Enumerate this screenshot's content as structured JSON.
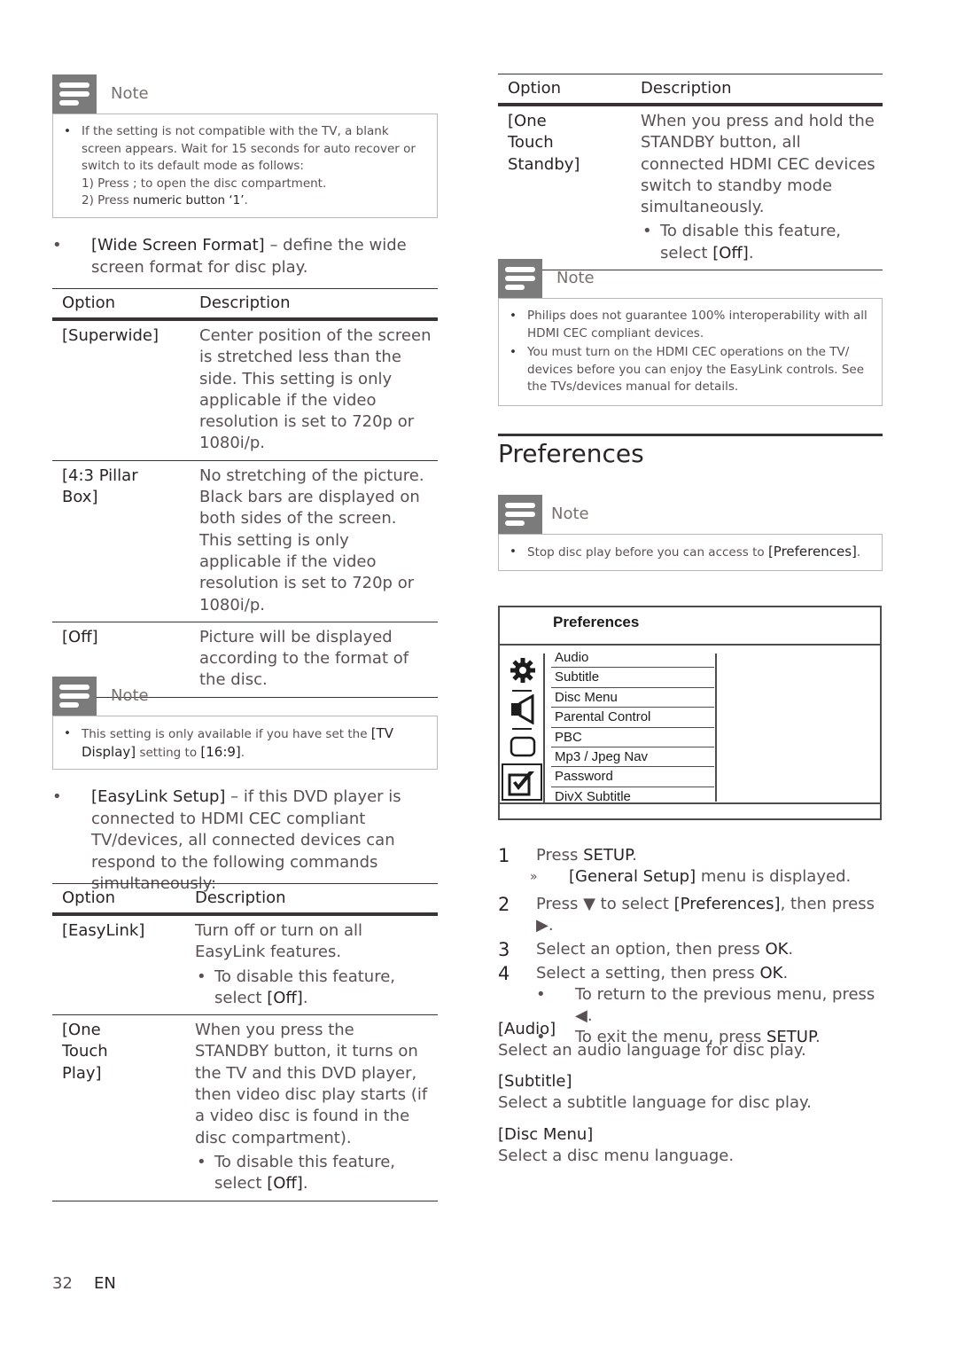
{
  "left": {
    "note1": {
      "title": "Note",
      "line1": "If the setting is not compatible with the TV, a blank screen appears.  Wait for 15 seconds for auto recover or switch to its default mode as follows:",
      "line2_pre": "1) Press  ;  to open the disc compartment.",
      "line3_pre": "2) Press ",
      "line3_bold": "numeric button ‘1’",
      "line3_post": "."
    },
    "wide_screen": {
      "bullet": "•",
      "term": "[Wide Screen Format]",
      "desc": " – define the wide screen format for disc play."
    },
    "table1": {
      "header": {
        "option": "Option",
        "description": "Description"
      },
      "rows": [
        {
          "option": "[Superwide]",
          "description": "Center position of the screen is stretched less than the side. This setting is only applicable if the video resolution is set to 720p or 1080i/p."
        },
        {
          "option": "[4:3 Pillar Box]",
          "description": "No stretching of the picture. Black bars are displayed on both sides of the screen. This setting is only applicable if the video resolution is set to 720p or 1080i/p."
        },
        {
          "option": "[Off]",
          "description": "Picture will be displayed according to the format of the disc."
        }
      ]
    },
    "note2": {
      "title": "Note",
      "pre": "This setting is only available if you have set the ",
      "bold1": "[TV Display]",
      "mid": " setting to ",
      "bold2": "[16:9]",
      "post": "."
    },
    "easylink": {
      "bullet": "•",
      "term": "[EasyLink Setup]",
      "desc": " – if this DVD player is connected to HDMI CEC compliant TV/devices, all connected devices can respond to the following commands simultaneously:"
    },
    "table2": {
      "header": {
        "option": "Option",
        "description": "Description"
      },
      "rows": [
        {
          "option": "[EasyLink]",
          "description": "Turn off or turn on all EasyLink features.",
          "sub_pre": "To disable this feature, select ",
          "sub_bold": "[Off]",
          "sub_post": "."
        },
        {
          "option": "[One Touch Play]",
          "description": "When you press the STANDBY button, it turns on the TV and this DVD player, then video disc play starts (if a video disc is found in the disc compartment).",
          "sub_pre": "To disable this feature, select ",
          "sub_bold": "[Off]",
          "sub_post": "."
        }
      ]
    }
  },
  "right": {
    "table3": {
      "header": {
        "option": "Option",
        "description": "Description"
      },
      "rows": [
        {
          "option": "[One Touch Standby]",
          "description": "When you press and hold the STANDBY button, all connected HDMI CEC devices switch to standby mode simultaneously.",
          "sub_pre": "To disable this feature, select ",
          "sub_bold": "[Off]",
          "sub_post": "."
        }
      ]
    },
    "note3": {
      "title": "Note",
      "items": [
        "Philips does not guarantee 100% interoperability with all HDMI CEC compliant devices.",
        "You must turn on the HDMI CEC operations on the TV/ devices before you can enjoy the EasyLink controls. See the TVs/devices manual for details."
      ]
    },
    "section_title": "Preferences",
    "note4": {
      "title": "Note",
      "pre": "Stop disc play before you can access to ",
      "bold": "[Preferences]",
      "post": "."
    },
    "menu": {
      "title": "Preferences",
      "sidebar_icons": [
        "gear-icon",
        "speaker-icon",
        "screen-icon",
        "checkbox-icon"
      ],
      "items": [
        "Audio",
        "Subtitle",
        "Disc Menu",
        "Parental Control",
        "PBC",
        "Mp3 / Jpeg Nav",
        "Password",
        "DivX Subtitle"
      ]
    },
    "steps": {
      "s1": {
        "num": "1",
        "pre": "Press ",
        "bold": "SETUP",
        "post": "."
      },
      "s1_sub": {
        "marker": "»",
        "bold": "[General Setup]",
        "post": " menu is displayed."
      },
      "s2": {
        "num": "2",
        "pre": "Press ▼ to select ",
        "bold": "[Preferences]",
        "post": ", then press ▶."
      },
      "s3": {
        "num": "3",
        "pre": "Select an option, then press ",
        "bold": "OK",
        "post": "."
      },
      "s4": {
        "num": "4",
        "pre": "Select a setting, then press ",
        "bold": "OK",
        "post": "."
      },
      "s4_sub1": {
        "marker": "•",
        "pre": "To return to the previous menu, press ◀."
      },
      "s4_sub2": {
        "marker": "•",
        "pre": "To exit the menu, press ",
        "bold": "SETUP",
        "post": "."
      }
    },
    "definitions": [
      {
        "term": "[Audio]",
        "desc": "Select an audio language for disc play."
      },
      {
        "term": "[Subtitle]",
        "desc": "Select a subtitle language for disc play."
      },
      {
        "term": "[Disc Menu]",
        "desc": "Select a disc menu language."
      }
    ]
  },
  "footer": {
    "page": "32",
    "lang": "EN"
  }
}
